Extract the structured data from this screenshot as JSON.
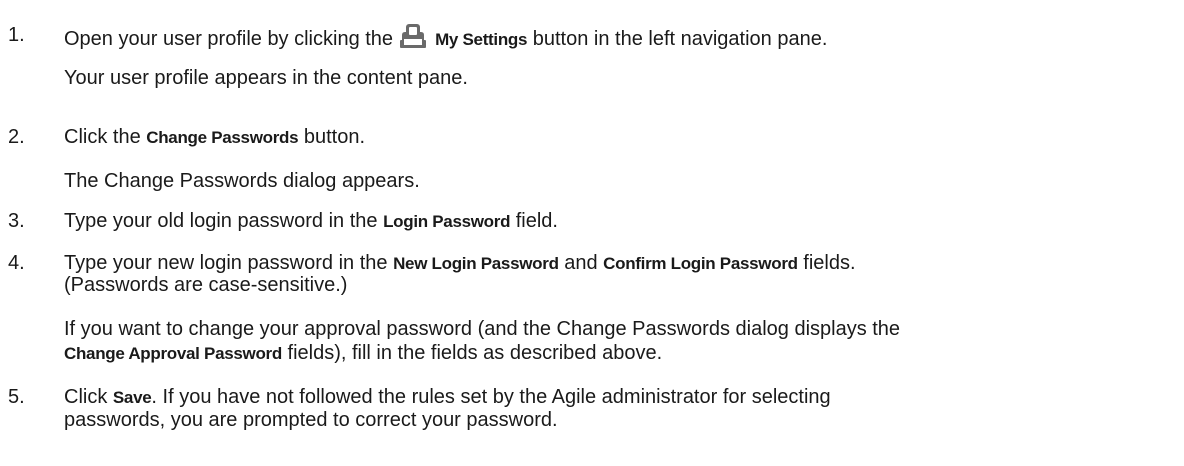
{
  "steps": [
    {
      "number": "1.",
      "before": "Open your user profile by clicking the",
      "icon": "user-profile-icon",
      "bold": "My Settings",
      "after": " button in the left navigation pane.",
      "result": "Your user profile appears in the content pane."
    },
    {
      "number": "2.",
      "before": "Click the ",
      "bold": "Change Passwords",
      "after": " button.",
      "result": "The Change Passwords dialog appears."
    },
    {
      "number": "3.",
      "before": "Type your old login password in the ",
      "bold": "Login Password",
      "after": " field."
    },
    {
      "number": "4.",
      "before": "Type your new login password in the ",
      "bold1": "New Login Password",
      "mid": " and ",
      "bold2": "Confirm Login Password",
      "after": " fields.",
      "line2": "(Passwords are case-sensitive.)",
      "note_line1": "If you want to change your approval password (and the Change Passwords dialog displays the",
      "note_bold": "Change Approval Password",
      "note_after": " fields), fill in the fields as described above."
    },
    {
      "number": "5.",
      "before": "Click ",
      "bold": "Save",
      "after": ". If you have not followed the rules set by the Agile administrator for selecting",
      "line2": "passwords, you are prompted to correct your password."
    }
  ]
}
